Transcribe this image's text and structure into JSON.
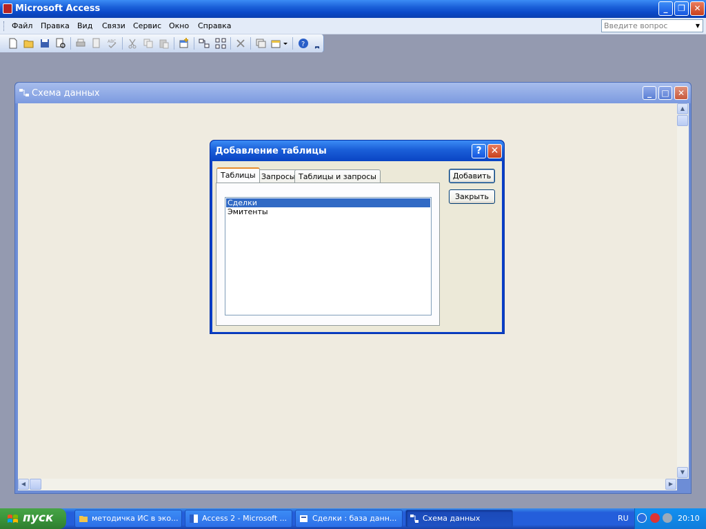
{
  "app": {
    "title": "Microsoft Access",
    "menu": [
      "Файл",
      "Правка",
      "Вид",
      "Связи",
      "Сервис",
      "Окно",
      "Справка"
    ],
    "menu_underline": [
      "Ф",
      "П",
      "В",
      "С",
      "С",
      "О",
      "С"
    ],
    "ask_placeholder": "Введите вопрос"
  },
  "toolbar": {
    "icons": [
      "new-icon",
      "open-icon",
      "save-icon",
      "print-preview-search-icon",
      "print-icon",
      "preview-icon",
      "spelling-icon",
      "cut-icon",
      "copy-icon",
      "paste-icon",
      "show-table-icon",
      "show-direct-icon",
      "show-all-icon",
      "delete-icon",
      "new-object-icon",
      "help-icon"
    ]
  },
  "child": {
    "title": "Схема данных"
  },
  "dialog": {
    "title": "Добавление таблицы",
    "help_glyph": "?",
    "close_glyph": "✕",
    "tabs": [
      "Таблицы",
      "Запросы",
      "Таблицы и запросы"
    ],
    "items": [
      "Сделки",
      "Эмитенты"
    ],
    "selected_index": 0,
    "add_label": "Добавить",
    "close_label": "Закрыть"
  },
  "taskbar": {
    "start_label": "пуск",
    "tasks": [
      "методичка ИС в эко...",
      "Access 2 - Microsoft ...",
      "Сделки : база данн...",
      "Схема данных"
    ],
    "active_task_index": 3,
    "language": "RU",
    "clock": "20:10"
  },
  "colors": {
    "title_blue": "#0a44c4",
    "selection": "#316ac5",
    "close_red": "#c8401c",
    "start_green": "#3a943a"
  }
}
